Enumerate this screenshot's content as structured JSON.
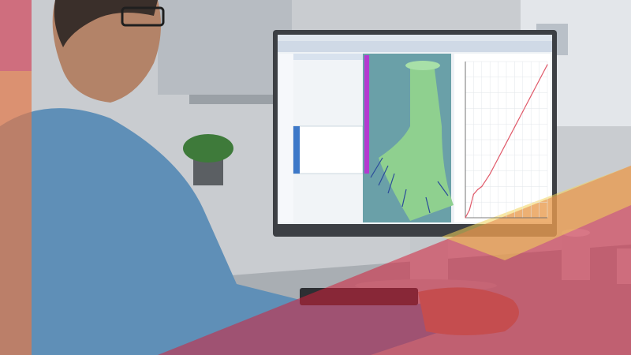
{
  "scene": {
    "description_tags": [
      "person",
      "desk",
      "monitor",
      "simulation-software",
      "office"
    ],
    "colors": {
      "wall": "#c9ccd0",
      "shirt": "#5f8fb7",
      "skin": "#b38368",
      "hair": "#3a2f2a",
      "monitor_frame": "#3c3f44",
      "ui_panel": "#eef2f6",
      "sim_background": "#6aa0a8",
      "sim_part": "#8fd08f",
      "chart_line": "#e05a6a",
      "overlay_red": "#d3203a",
      "overlay_yellow": "#f2d35a",
      "desk": "#a9aeb3",
      "plant": "#3e7a3a"
    }
  },
  "monitor": {
    "title_bar": "",
    "chart": {
      "title": "",
      "xlabel": ""
    }
  },
  "chart_data": {
    "type": "line",
    "x": [
      0,
      0.05,
      0.1,
      0.15,
      0.2,
      0.3,
      0.4,
      0.5,
      0.6,
      0.7,
      0.8,
      0.9,
      1.0
    ],
    "y": [
      0,
      0.05,
      0.15,
      0.18,
      0.2,
      0.28,
      0.38,
      0.48,
      0.58,
      0.68,
      0.78,
      0.88,
      0.98
    ],
    "xlim": [
      0,
      1
    ],
    "ylim": [
      0,
      1
    ],
    "grid": true
  }
}
